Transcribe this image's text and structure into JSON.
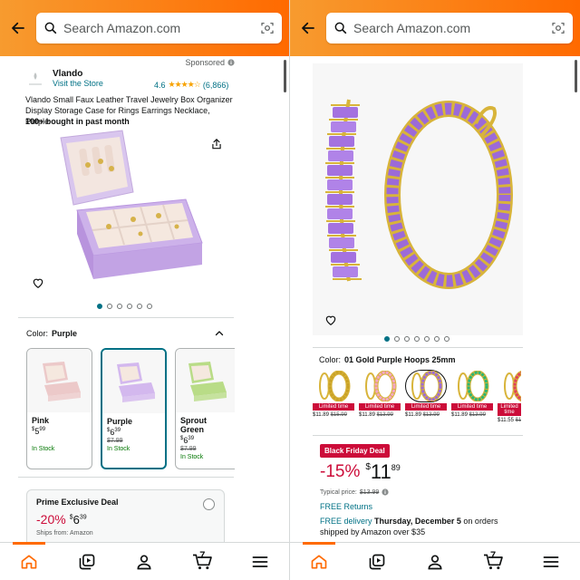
{
  "colors": {
    "header_start": "#f79b2f",
    "header_end": "#ff6a00",
    "link": "#007185",
    "deal_red": "#cc0c39",
    "in_stock": "#007600"
  },
  "left": {
    "search": {
      "placeholder": "Search Amazon.com"
    },
    "sponsored": "Sponsored",
    "brand": {
      "name": "Vlando",
      "visit": "Visit the Store"
    },
    "rating": {
      "value": "4.6",
      "count": "(6,866)",
      "stars": "★★★★☆"
    },
    "title": "Vlando Small Faux Leather Travel Jewelry Box Organizer Display Storage Case for Rings Earrings Necklace, Purple",
    "bought": "100+ bought in past month",
    "color_label": "Color:",
    "color_value": "Purple",
    "swatches": [
      {
        "name": "Pink",
        "price_whole": "5",
        "price_frac": "99",
        "currency": "$",
        "list": "",
        "stock": "In Stock"
      },
      {
        "name": "Purple",
        "price_whole": "6",
        "price_frac": "39",
        "currency": "$",
        "list": "$7.99",
        "stock": "In Stock"
      },
      {
        "name": "Sprout Green",
        "price_whole": "6",
        "price_frac": "39",
        "currency": "$",
        "list": "$7.99",
        "stock": "In Stock"
      }
    ],
    "deal": {
      "title": "Prime Exclusive Deal",
      "pct": "-20%",
      "currency": "$",
      "whole": "6",
      "frac": "39",
      "ships": "Ships from: Amazon"
    },
    "image_dots": 6,
    "active_dot": 0,
    "scroll_position": 0.02
  },
  "right": {
    "search": {
      "placeholder": "Search Amazon.com"
    },
    "color_label": "Color:",
    "color_value": "01 Gold Purple Hoops 25mm",
    "hoops": [
      {
        "color": "#c9a227",
        "badge": "Limited time",
        "price": "$11.89",
        "list": "$15.99"
      },
      {
        "color": "#f4a6c6",
        "badge": "Limited time",
        "price": "$11.89",
        "list": "$13.99"
      },
      {
        "color": "#9c6ad8",
        "badge": "Limited time",
        "price": "$11.89",
        "list": "$13.99"
      },
      {
        "color": "#2bb673",
        "badge": "Limited time",
        "price": "$11.89",
        "list": "$13.99"
      },
      {
        "color": "#e0405a",
        "badge": "Limited time",
        "price": "$11.55",
        "list": "$1"
      }
    ],
    "badge": "Black Friday Deal",
    "pct": "-15%",
    "currency": "$",
    "whole": "11",
    "frac": "89",
    "typical_label": "Typical price:",
    "typical_price": "$13.99",
    "free_returns": "FREE Returns",
    "free_delivery_prefix": "FREE delivery",
    "free_delivery_date": "Thursday, December 5",
    "free_delivery_suffix": "on orders shipped by Amazon over $35",
    "image_dots": 7,
    "active_dot": 0,
    "scroll_position": 0.02
  },
  "nav": {
    "items": [
      "home-icon",
      "library-icon",
      "account-icon",
      "cart-icon",
      "menu-icon"
    ],
    "cart_count": "7",
    "active": "home"
  }
}
